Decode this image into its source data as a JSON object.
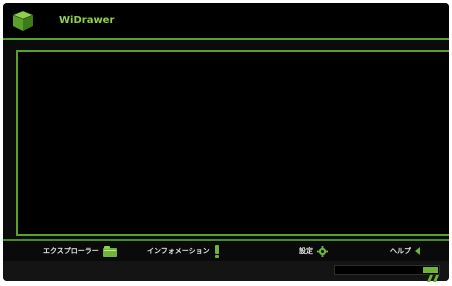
{
  "app": {
    "title": "WiDrawer"
  },
  "toolbar": {
    "explorer_label": "エクスプローラー",
    "info_label": "インフォメーション",
    "settings_label": "設定",
    "help_label": "ヘルプ"
  },
  "colors": {
    "accent": "#5aa12c",
    "title": "#8ed04a",
    "background": "#000000",
    "icon_green": "#6fb33a"
  },
  "icons": {
    "logo": "cube-logo-icon",
    "explorer": "folder-icon",
    "info": "exclamation-icon",
    "settings": "gear-icon",
    "help": "arrow-left-icon"
  },
  "status": {
    "progress_fraction": 0.15
  }
}
